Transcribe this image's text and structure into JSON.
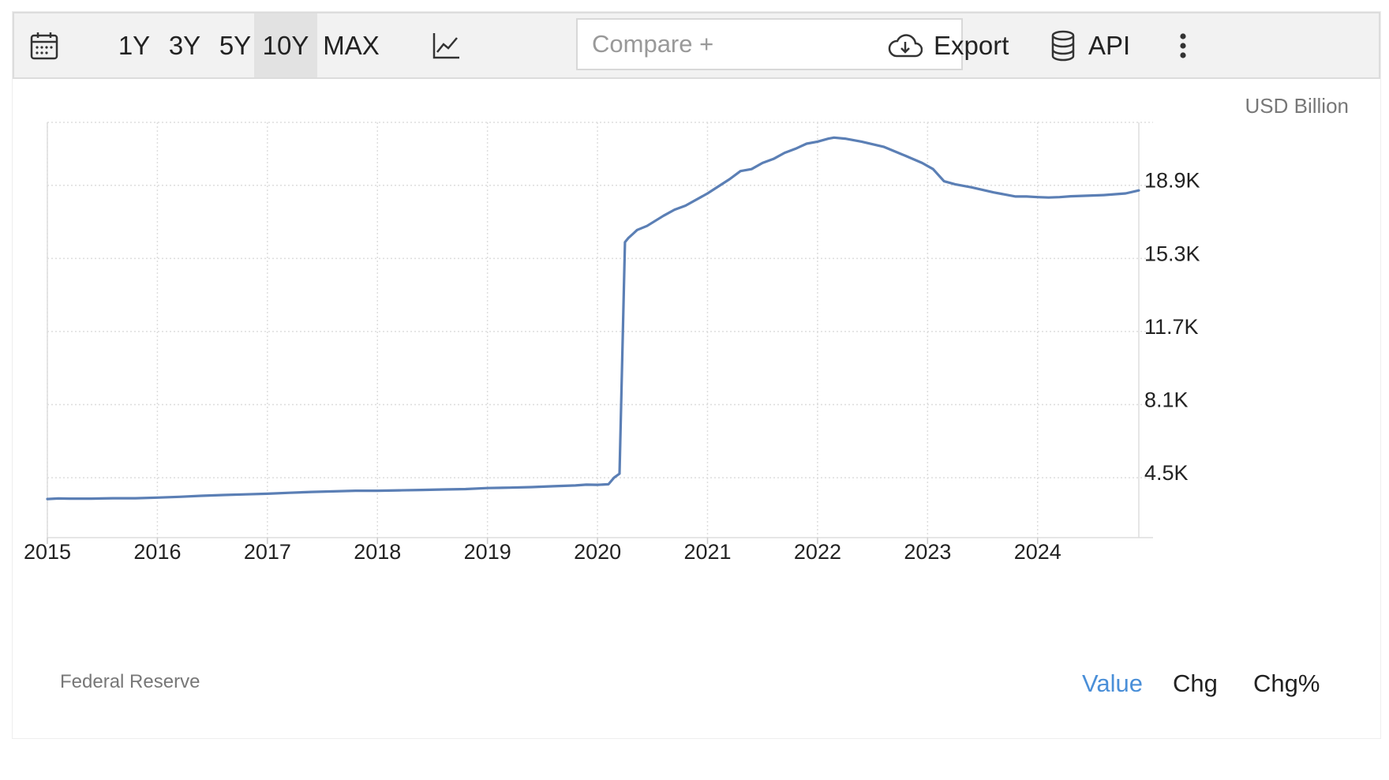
{
  "toolbar": {
    "calendar_icon": "calendar-icon",
    "ranges": [
      "1Y",
      "3Y",
      "5Y",
      "10Y",
      "MAX"
    ],
    "active_range": "10Y",
    "chart_type_icon": "line-chart-icon",
    "compare_placeholder": "Compare +",
    "export_label": "Export",
    "export_icon": "cloud-download-icon",
    "api_label": "API",
    "api_icon": "database-icon",
    "more_icon": "vertical-ellipsis-icon"
  },
  "footer": {
    "source": "Federal Reserve",
    "modes": [
      "Value",
      "Chg",
      "Chg%"
    ],
    "active_mode": "Value"
  },
  "colors": {
    "line": "#5b7fb5",
    "accent": "#4a8fd8",
    "grid": "#dddddd"
  },
  "chart_data": {
    "type": "line",
    "unit": "USD Billion",
    "x_ticks": [
      "2015",
      "2016",
      "2017",
      "2018",
      "2019",
      "2020",
      "2021",
      "2022",
      "2023",
      "2024"
    ],
    "y_ticks": [
      "4.5K",
      "8.1K",
      "11.7K",
      "15.3K",
      "18.9K"
    ],
    "y_tick_values": [
      4500,
      8100,
      11700,
      15300,
      18900
    ],
    "xlim": [
      2015.0,
      2024.92
    ],
    "ylim": [
      1550,
      22000
    ],
    "grid": true,
    "series": [
      {
        "x": [
          2015.0,
          2015.1,
          2015.2,
          2015.4,
          2015.6,
          2015.8,
          2016.0,
          2016.2,
          2016.4,
          2016.6,
          2016.8,
          2017.0,
          2017.2,
          2017.4,
          2017.6,
          2017.8,
          2018.0,
          2018.2,
          2018.4,
          2018.6,
          2018.8,
          2019.0,
          2019.2,
          2019.4,
          2019.6,
          2019.8,
          2019.9,
          2020.0,
          2020.1,
          2020.15,
          2020.2,
          2020.25,
          2020.28,
          2020.32,
          2020.36,
          2020.45,
          2020.6,
          2020.7,
          2020.8,
          2021.0,
          2021.2,
          2021.3,
          2021.4,
          2021.5,
          2021.6,
          2021.7,
          2021.8,
          2021.9,
          2022.0,
          2022.1,
          2022.15,
          2022.25,
          2022.4,
          2022.6,
          2022.8,
          2022.95,
          2023.05,
          2023.15,
          2023.25,
          2023.4,
          2023.6,
          2023.8,
          2023.9,
          2024.0,
          2024.1,
          2024.2,
          2024.3,
          2024.4,
          2024.5,
          2024.6,
          2024.8,
          2024.92
        ],
        "y": [
          3450,
          3480,
          3470,
          3470,
          3490,
          3490,
          3520,
          3560,
          3610,
          3650,
          3680,
          3710,
          3760,
          3800,
          3830,
          3860,
          3860,
          3880,
          3900,
          3920,
          3940,
          3990,
          4010,
          4040,
          4080,
          4120,
          4160,
          4150,
          4180,
          4500,
          4700,
          16100,
          16300,
          16500,
          16700,
          16900,
          17400,
          17700,
          17900,
          18500,
          19200,
          19600,
          19700,
          20000,
          20200,
          20500,
          20700,
          20950,
          21050,
          21200,
          21250,
          21200,
          21050,
          20800,
          20350,
          20000,
          19700,
          19100,
          18950,
          18800,
          18550,
          18350,
          18350,
          18320,
          18300,
          18320,
          18360,
          18380,
          18400,
          18420,
          18500,
          18650
        ]
      }
    ]
  }
}
